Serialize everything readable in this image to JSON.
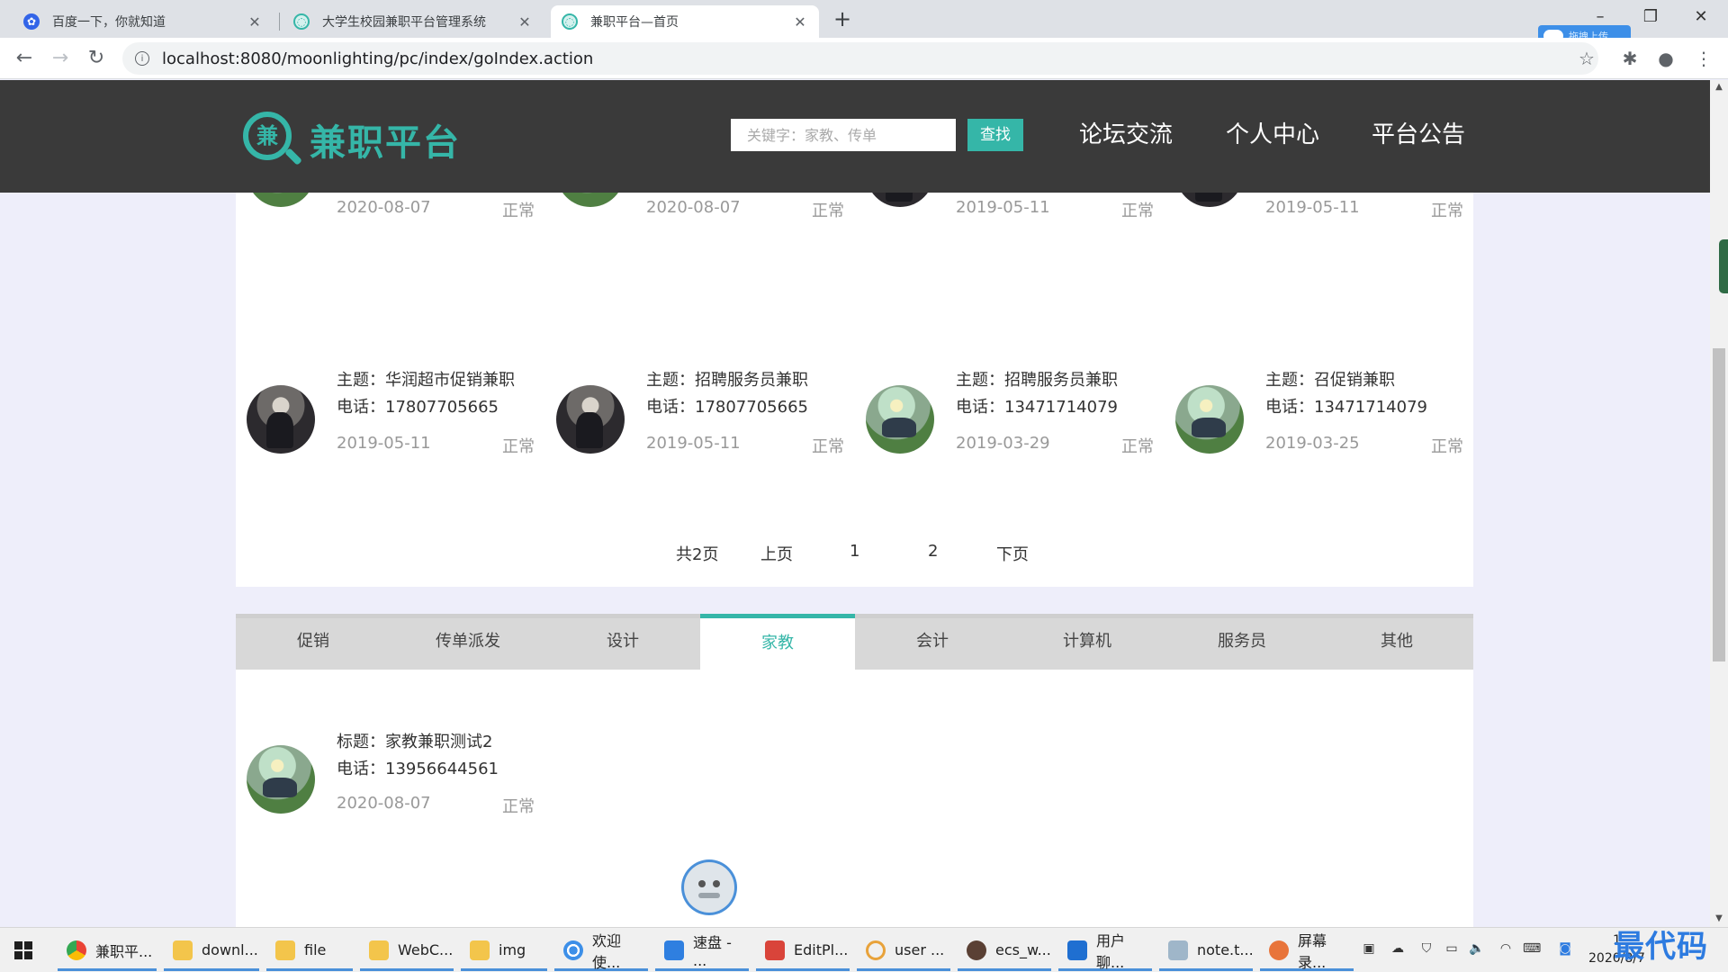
{
  "browser": {
    "tabs": [
      {
        "title": "百度一下，你就知道",
        "active": false
      },
      {
        "title": "大学生校园兼职平台管理系统",
        "active": false
      },
      {
        "title": "兼职平台—首页",
        "active": true
      }
    ],
    "url_host": "localhost",
    "url_rest": ":8080/moonlighting/pc/index/goIndex.action",
    "cloud_badge": "拖拽上传"
  },
  "header": {
    "logo_glyph": "兼",
    "logo_text": "兼职平台",
    "search_placeholder": "关键字：家教、传单",
    "search_button": "查找",
    "nav": [
      "论坛交流",
      "个人中心",
      "平台公告"
    ]
  },
  "jobs_partial": [
    {
      "date": "2020-08-07",
      "status": "正常"
    },
    {
      "date": "2020-08-07",
      "status": "正常"
    },
    {
      "date": "2019-05-11",
      "status": "正常"
    },
    {
      "date": "2019-05-11",
      "status": "正常"
    }
  ],
  "jobs": [
    {
      "title": "主题：华润超市促销兼职",
      "phone": "电话：17807705665",
      "date": "2019-05-11",
      "status": "正常",
      "avatar": "warrior"
    },
    {
      "title": "主题：招聘服务员兼职",
      "phone": "电话：17807705665",
      "date": "2019-05-11",
      "status": "正常",
      "avatar": "warrior"
    },
    {
      "title": "主题：招聘服务员兼职",
      "phone": "电话：13471714079",
      "date": "2019-03-29",
      "status": "正常",
      "avatar": "field"
    },
    {
      "title": "主题：召促销兼职",
      "phone": "电话：13471714079",
      "date": "2019-03-25",
      "status": "正常",
      "avatar": "field"
    }
  ],
  "pagination": {
    "total": "共2页",
    "prev": "上页",
    "page1": "1",
    "page2": "2",
    "next": "下页"
  },
  "categories": [
    "促销",
    "传单派发",
    "设计",
    "家教",
    "会计",
    "计算机",
    "服务员",
    "其他"
  ],
  "active_category": "家教",
  "category_jobs": [
    {
      "title": "标题：家教兼职测试2",
      "phone": "电话：13956644561",
      "date": "2020-08-07",
      "status": "正常",
      "avatar": "field"
    }
  ],
  "taskbar": {
    "items": [
      "兼职平...",
      "downl...",
      "file",
      "WebC...",
      "img",
      "欢迎使...",
      "速盘 - ...",
      "EditPl...",
      "user ...",
      "ecs_w...",
      "用户聊...",
      "note.t...",
      "屏幕录..."
    ],
    "clock_time": "1",
    "clock_date": "2020/8/7"
  },
  "watermark": "最代码",
  "colors": {
    "accent": "#35b6a8",
    "header_bg": "#3a3a3a",
    "page_bg": "#eeeefa"
  }
}
